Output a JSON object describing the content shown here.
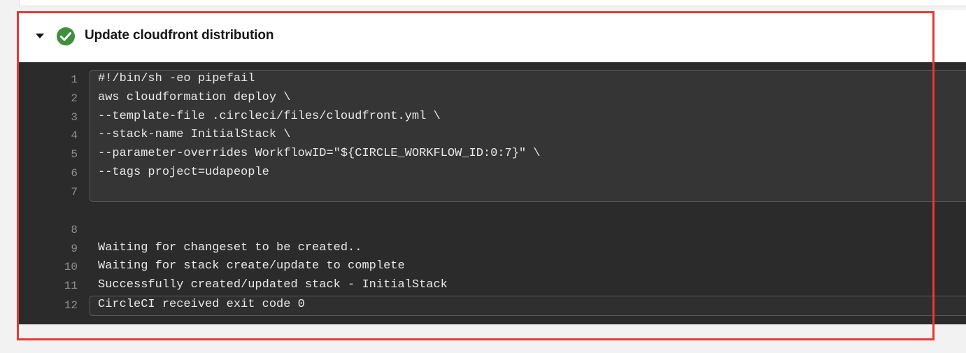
{
  "step": {
    "title": "Update cloudfront distribution",
    "status": "success",
    "status_color": "#3f8f3f",
    "expanded": true
  },
  "log": {
    "lines": [
      {
        "num": "1",
        "text": "#!/bin/sh -eo pipefail"
      },
      {
        "num": "2",
        "text": "aws cloudformation deploy \\"
      },
      {
        "num": "3",
        "text": "--template-file .circleci/files/cloudfront.yml \\"
      },
      {
        "num": "4",
        "text": "--stack-name InitialStack \\"
      },
      {
        "num": "5",
        "text": "--parameter-overrides WorkflowID=\"${CIRCLE_WORKFLOW_ID:0:7}\" \\"
      },
      {
        "num": "6",
        "text": "--tags project=udapeople"
      },
      {
        "num": "7",
        "text": ""
      },
      {
        "num": "8",
        "text": ""
      },
      {
        "num": "9",
        "text": "Waiting for changeset to be created.."
      },
      {
        "num": "10",
        "text": "Waiting for stack create/update to complete"
      },
      {
        "num": "11",
        "text": "Successfully created/updated stack - InitialStack"
      },
      {
        "num": "12",
        "text": "CircleCI received exit code 0"
      }
    ]
  },
  "annotation": {
    "color": "#e53935"
  }
}
